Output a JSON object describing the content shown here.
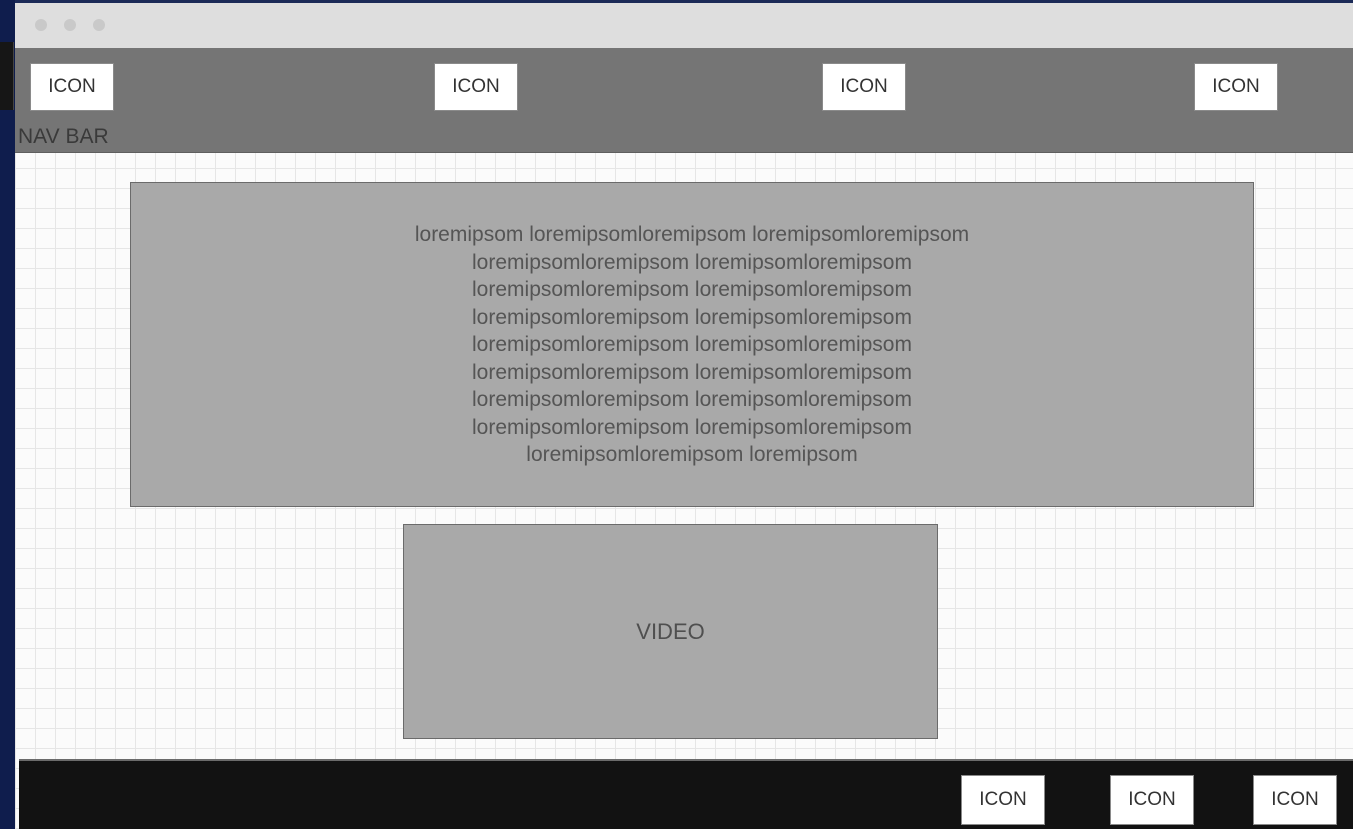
{
  "window": {
    "controls": [
      "close",
      "minimize",
      "maximize"
    ]
  },
  "navbar": {
    "label": "NAV BAR",
    "icons": [
      "ICON",
      "ICON",
      "ICON",
      "ICON"
    ]
  },
  "main": {
    "text_lines": [
      "loremipsom loremipsomloremipsom loremipsomloremipsom",
      "loremipsomloremipsom loremipsomloremipsom",
      "loremipsomloremipsom loremipsomloremipsom",
      "loremipsomloremipsom loremipsomloremipsom",
      "loremipsomloremipsom loremipsomloremipsom",
      "loremipsomloremipsom loremipsomloremipsom",
      "loremipsomloremipsom loremipsomloremipsom",
      "loremipsomloremipsom loremipsomloremipsom",
      "loremipsomloremipsom loremipsom"
    ],
    "video_label": "VIDEO"
  },
  "footer": {
    "icons": [
      "ICON",
      "ICON",
      "ICON"
    ]
  },
  "colors": {
    "navbar_bg": "#757575",
    "block_bg": "#a9a9a9",
    "footer_bg": "#121212",
    "outer_bg": "#1b2a57"
  }
}
